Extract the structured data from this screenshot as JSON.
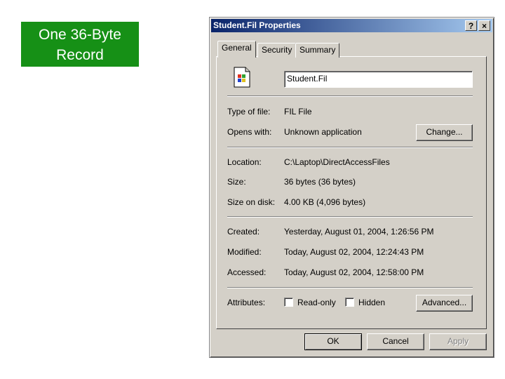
{
  "slide": {
    "label_line1": "One 36-Byte",
    "label_line2": "Record"
  },
  "dialog": {
    "title": "Student.Fil Properties",
    "help_glyph": "?",
    "close_glyph": "×",
    "tabs": [
      {
        "label": "General",
        "active": true
      },
      {
        "label": "Security",
        "active": false
      },
      {
        "label": "Summary",
        "active": false
      }
    ],
    "file_name": "Student.Fil",
    "fields": {
      "type_label": "Type of file:",
      "type_value": "FIL File",
      "opens_label": "Opens with:",
      "opens_value": "Unknown application",
      "location_label": "Location:",
      "location_value": "C:\\Laptop\\DirectAccessFiles",
      "size_label": "Size:",
      "size_value": "36 bytes (36 bytes)",
      "disk_label": "Size on disk:",
      "disk_value": "4.00 KB (4,096 bytes)",
      "created_label": "Created:",
      "created_value": "Yesterday, August 01, 2004, 1:26:56 PM",
      "modified_label": "Modified:",
      "modified_value": "Today, August 02, 2004, 12:24:43 PM",
      "accessed_label": "Accessed:",
      "accessed_value": "Today, August 02, 2004, 12:58:00 PM",
      "attributes_label": "Attributes:"
    },
    "attributes": {
      "readonly_label": "Read-only",
      "readonly_checked": false,
      "hidden_label": "Hidden",
      "hidden_checked": false
    },
    "buttons": {
      "change": "Change...",
      "advanced": "Advanced...",
      "ok": "OK",
      "cancel": "Cancel",
      "apply": "Apply"
    },
    "icons": {
      "file": "windows-file-icon"
    }
  }
}
